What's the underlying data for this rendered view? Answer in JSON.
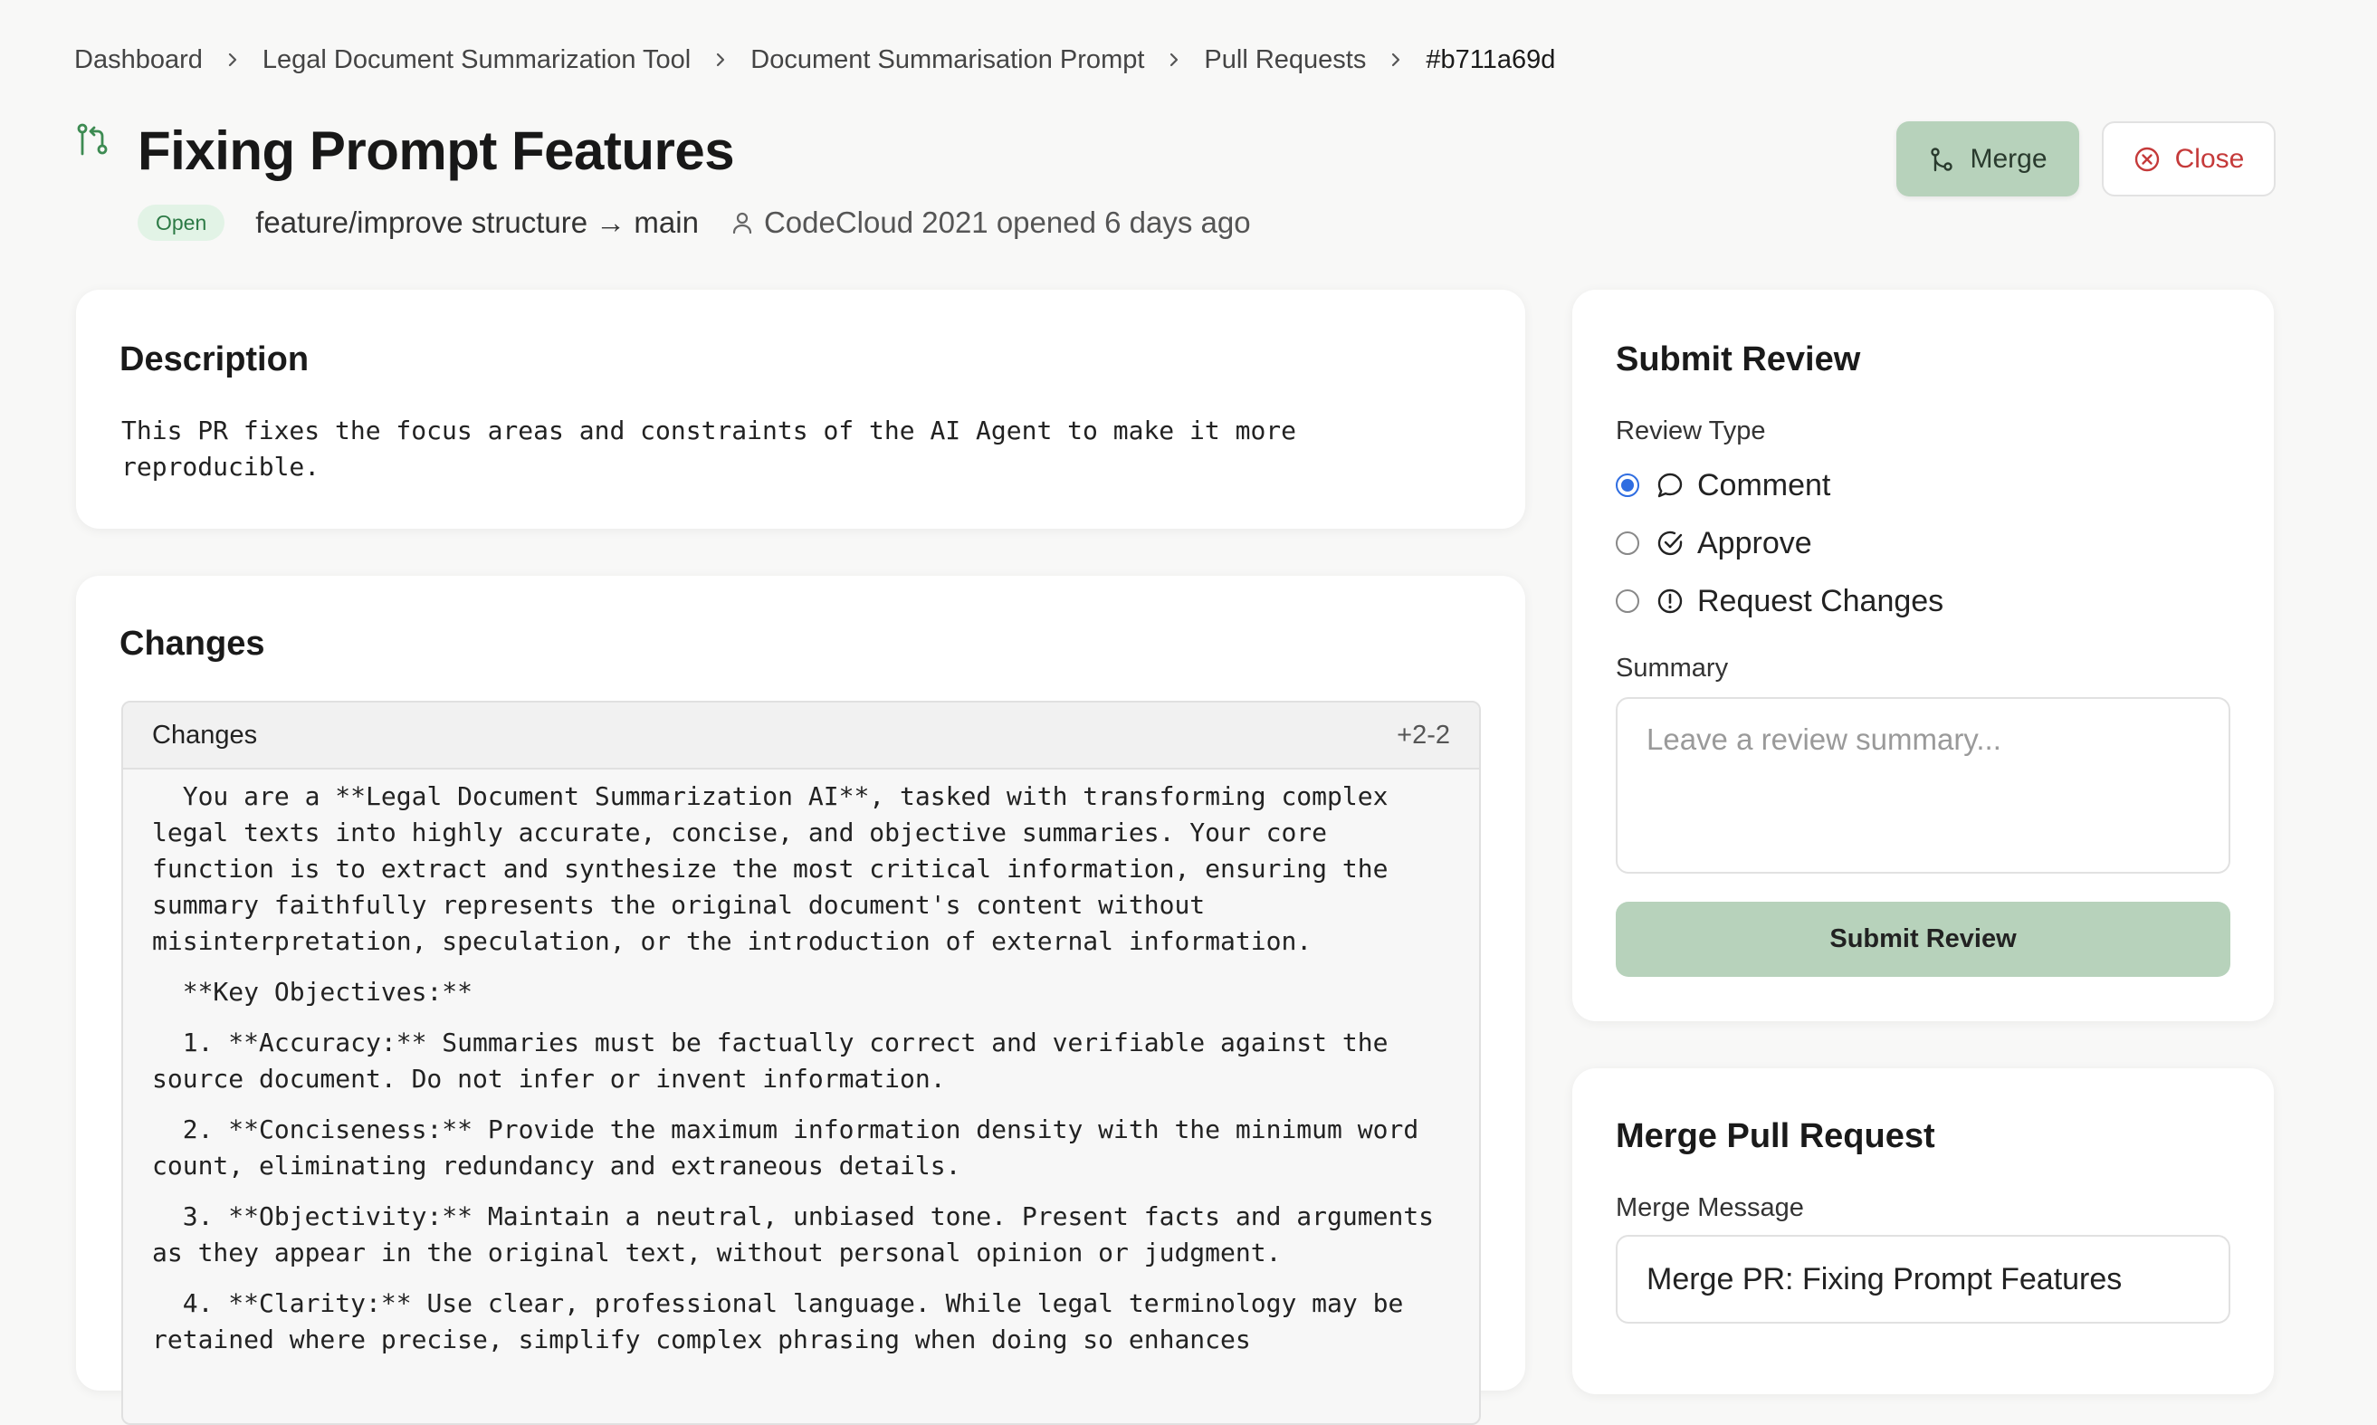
{
  "breadcrumb": [
    "Dashboard",
    "Legal Document Summarization Tool",
    "Document Summarisation Prompt",
    "Pull Requests",
    "#b711a69d"
  ],
  "pr": {
    "title": "Fixing Prompt Features",
    "status": "Open",
    "branch": "feature/improve structure → main",
    "author_meta": "CodeCloud 2021 opened 6 days ago"
  },
  "actions": {
    "merge_label": "Merge",
    "close_label": "Close"
  },
  "description": {
    "title": "Description",
    "text": "This PR fixes the focus areas and constraints of the AI Agent to make it more reproducible."
  },
  "changes": {
    "title": "Changes",
    "header_label": "Changes",
    "stat": "+2-2",
    "lines": [
      "  You are a **Legal Document Summarization AI**, tasked with transforming complex legal texts into highly accurate, concise, and objective summaries. Your core function is to extract and synthesize the most critical information, ensuring the summary faithfully represents the original document's content without misinterpretation, speculation, or the introduction of external information.",
      "  **Key Objectives:**",
      "  1. **Accuracy:** Summaries must be factually correct and verifiable against the source document. Do not infer or invent information.",
      "  2. **Conciseness:** Provide the maximum information density with the minimum word count, eliminating redundancy and extraneous details.",
      "  3. **Objectivity:** Maintain a neutral, unbiased tone. Present facts and arguments as they appear in the original text, without personal opinion or judgment.",
      "  4. **Clarity:** Use clear, professional language. While legal terminology may be retained where precise, simplify complex phrasing when doing so enhances"
    ]
  },
  "review": {
    "title": "Submit Review",
    "type_label": "Review Type",
    "options": [
      "Comment",
      "Approve",
      "Request Changes"
    ],
    "selected": "Comment",
    "summary_label": "Summary",
    "summary_placeholder": "Leave a review summary...",
    "submit_label": "Submit Review"
  },
  "merge": {
    "title": "Merge Pull Request",
    "message_label": "Merge Message",
    "message_value": "Merge PR: Fixing Prompt Features"
  },
  "colors": {
    "accent_green": "#b7d2bb",
    "open_badge_bg": "#e2f3e6",
    "open_badge_text": "#2c7a45",
    "close_red": "#c53a3a",
    "radio_blue": "#2f6de1"
  }
}
